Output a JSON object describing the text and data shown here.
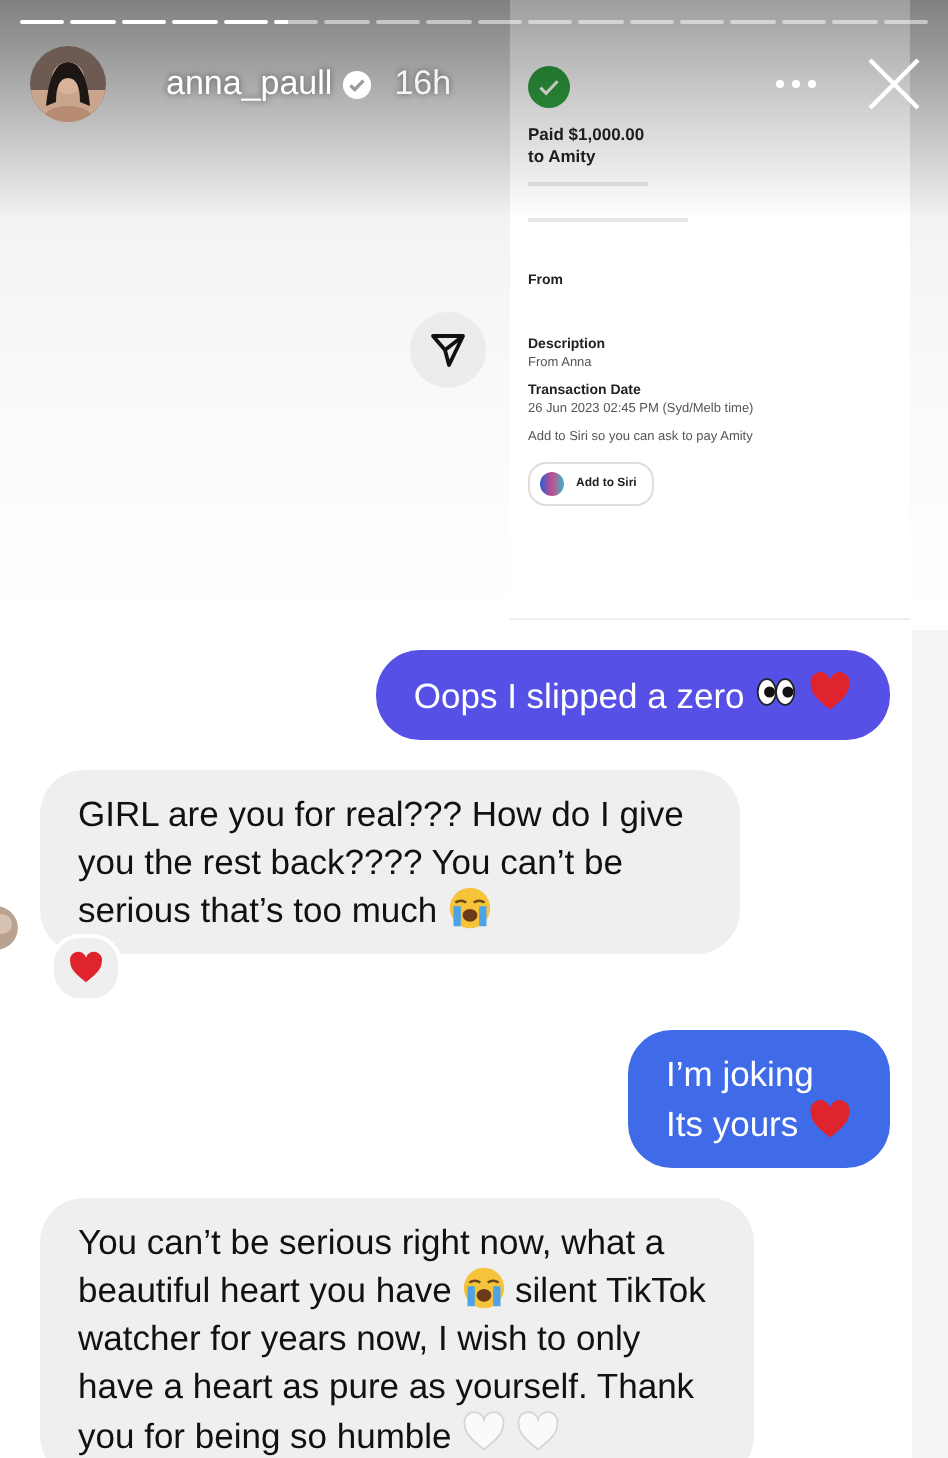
{
  "progress": [
    {
      "level": 1
    },
    {
      "level": 1
    },
    {
      "level": 1
    },
    {
      "level": 1
    },
    {
      "level": 1
    },
    {
      "level": 0.3
    },
    {
      "level": 0
    },
    {
      "level": 0
    },
    {
      "level": 0
    },
    {
      "level": 0
    },
    {
      "level": 0
    },
    {
      "level": 0
    },
    {
      "level": 0
    },
    {
      "level": 0
    },
    {
      "level": 0
    },
    {
      "level": 0
    },
    {
      "level": 0
    },
    {
      "level": 0
    }
  ],
  "header": {
    "username": "anna_paull",
    "verified": true,
    "time": "16h"
  },
  "receipt": {
    "title": "Paid $1,000.00",
    "recipient": "to Amity",
    "from_label": "From",
    "description_label": "Description",
    "description": "From Anna",
    "date_label": "Transaction Date",
    "date": "26 Jun 2023 02:45 PM (Syd/Melb time)",
    "siri_hint": "Add to Siri so you can ask to pay Amity",
    "siri_button": "Add to Siri"
  },
  "messages": [
    {
      "kind": "outgoing",
      "parts": [
        {
          "kind": "text",
          "text": "Oops I slipped a zero"
        },
        {
          "kind": "eyes"
        },
        {
          "kind": "heart"
        }
      ]
    },
    {
      "kind": "incoming",
      "avatar": true,
      "parts": [
        {
          "kind": "text",
          "text": "GIRL are you for real??? How do I give you the rest back???? You can’t be serious that’s too much"
        },
        {
          "kind": "crying"
        }
      ],
      "reaction": {
        "kind": "heart"
      }
    },
    {
      "kind": "outgoing",
      "parts": [
        {
          "kind": "text",
          "text": "I’m joking\nIts yours"
        },
        {
          "kind": "heart"
        }
      ]
    },
    {
      "kind": "incoming",
      "parts": [
        {
          "kind": "text",
          "text": "You can’t be serious right now, what a beautiful heart you have"
        },
        {
          "kind": "crying"
        },
        {
          "kind": "text",
          "text": "silent TikTok watcher for years now, I wish to only have a heart as pure as yourself. Thank you for being so humble"
        },
        {
          "kind": "white-heart"
        },
        {
          "kind": "white-heart"
        }
      ]
    }
  ]
}
